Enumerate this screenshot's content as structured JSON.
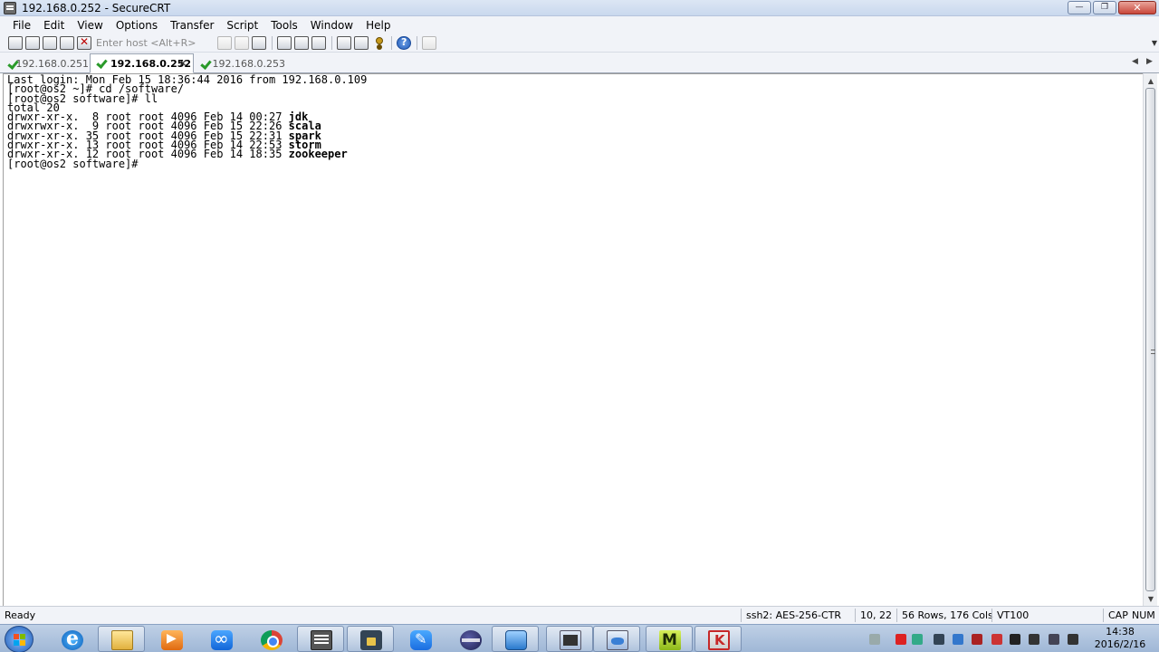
{
  "window": {
    "title": "192.168.0.252 - SecureCRT",
    "controls": [
      "—",
      "❐",
      "✕"
    ]
  },
  "menu": [
    "File",
    "Edit",
    "View",
    "Options",
    "Transfer",
    "Script",
    "Tools",
    "Window",
    "Help"
  ],
  "toolbar": {
    "host_placeholder": "Enter host <Alt+R>"
  },
  "tabs": [
    {
      "label": "192.168.0.251",
      "active": false
    },
    {
      "label": "192.168.0.252",
      "active": true,
      "close": "✕"
    },
    {
      "label": "192.168.0.253",
      "active": false
    }
  ],
  "tab_nav": {
    "left": "◀",
    "right": "▶"
  },
  "terminal": {
    "lines": [
      {
        "text": "Last login: Mon Feb 15 18:36:44 2016 from 192.168.0.109",
        "name": ""
      },
      {
        "text": "[root@os2 ~]# cd /software/",
        "name": ""
      },
      {
        "text": "[root@os2 software]# ll",
        "name": ""
      },
      {
        "text": "total 20",
        "name": ""
      },
      {
        "text": "drwxr-xr-x.  8 root root 4096 Feb 14 00:27 ",
        "name": "jdk"
      },
      {
        "text": "drwxrwxr-x.  9 root root 4096 Feb 15 22:26 ",
        "name": "scala"
      },
      {
        "text": "drwxr-xr-x. 35 root root 4096 Feb 15 22:31 ",
        "name": "spark"
      },
      {
        "text": "drwxr-xr-x. 13 root root 4096 Feb 14 22:53 ",
        "name": "storm"
      },
      {
        "text": "drwxr-xr-x. 12 root root 4096 Feb 14 18:35 ",
        "name": "zookeeper"
      },
      {
        "text": "[root@os2 software]#",
        "name": ""
      }
    ]
  },
  "scrollbar": {
    "up": "▲",
    "down": "▼"
  },
  "status": {
    "ready": "Ready",
    "cipher": "ssh2: AES-256-CTR",
    "cursor": "10,  22",
    "size": "56 Rows, 176 Cols",
    "emulation": "VT100",
    "cap": "CAP",
    "num": "NUM"
  },
  "taskbar": {
    "clock_time": "14:38",
    "clock_date": "2016/2/16",
    "tray_colors": [
      "#9aa",
      "#d22",
      "#3a8",
      "#345",
      "#37c",
      "#a22",
      "#c33",
      "#222",
      "#333",
      "#445",
      "#333"
    ]
  },
  "colors": {
    "accent": "#2a9a2a",
    "close_red": "#c8463a"
  }
}
